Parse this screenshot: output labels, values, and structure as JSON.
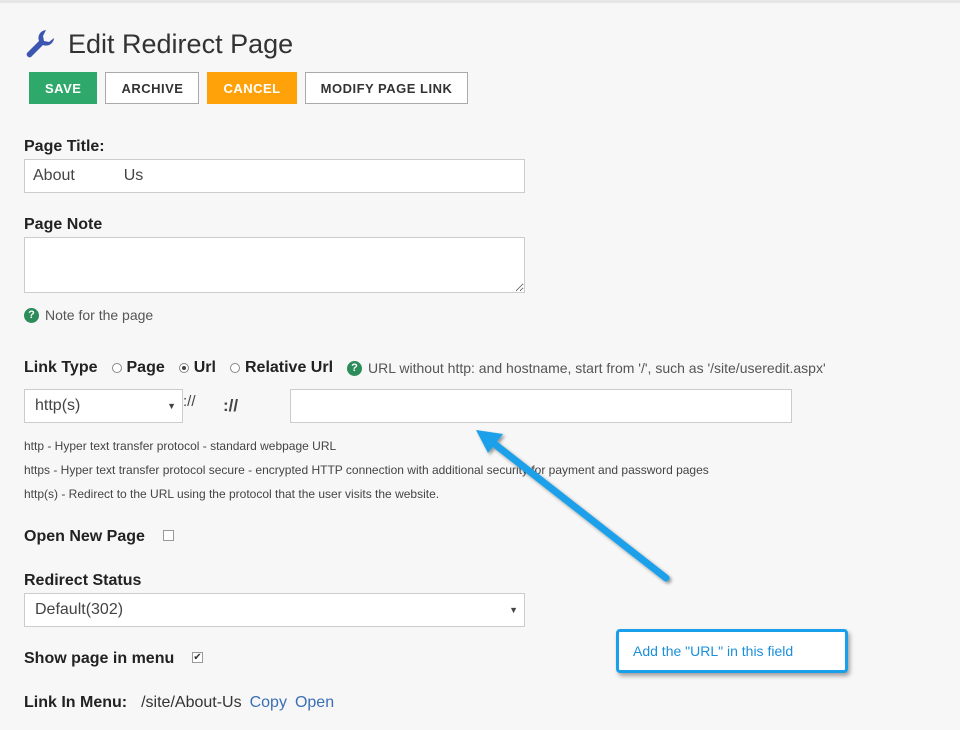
{
  "header": {
    "title": "Edit Redirect Page",
    "icon": "wrench-icon"
  },
  "toolbar": {
    "save_label": "SAVE",
    "archive_label": "ARCHIVE",
    "cancel_label": "CANCEL",
    "modify_label": "MODIFY PAGE LINK",
    "colors": {
      "save": "#2fa96b",
      "cancel": "#ffa20a"
    }
  },
  "page_title": {
    "label": "Page Title:",
    "value": "About           Us"
  },
  "page_note": {
    "label": "Page Note",
    "value": "",
    "help": "Note for the page"
  },
  "link_type": {
    "label": "Link Type",
    "options": [
      "Page",
      "Url",
      "Relative Url"
    ],
    "selected": "Url",
    "help": "URL without http: and hostname, start from '/', such as '/site/useredit.aspx'"
  },
  "url": {
    "protocol": "http(s)",
    "separator_small": "://",
    "separator": "://",
    "value": "",
    "descriptions": [
      "http - Hyper text transfer protocol - standard webpage URL",
      "https - Hyper text transfer protocol secure - encrypted HTTP connection with additional security for payment and password pages",
      "http(s) - Redirect to the URL using the protocol that the user visits the website."
    ]
  },
  "open_new_page": {
    "label": "Open New Page",
    "checked": false
  },
  "redirect_status": {
    "label": "Redirect Status",
    "value": "Default(302)"
  },
  "show_in_menu": {
    "label": "Show page in menu",
    "checked": true,
    "mark": "✔"
  },
  "link_in_menu": {
    "label": "Link In Menu:",
    "path": "/site/About-Us",
    "copy": "Copy",
    "open": "Open"
  },
  "annotation": {
    "text": "Add the \"URL\" in this field",
    "color": "#1aa0ea"
  }
}
